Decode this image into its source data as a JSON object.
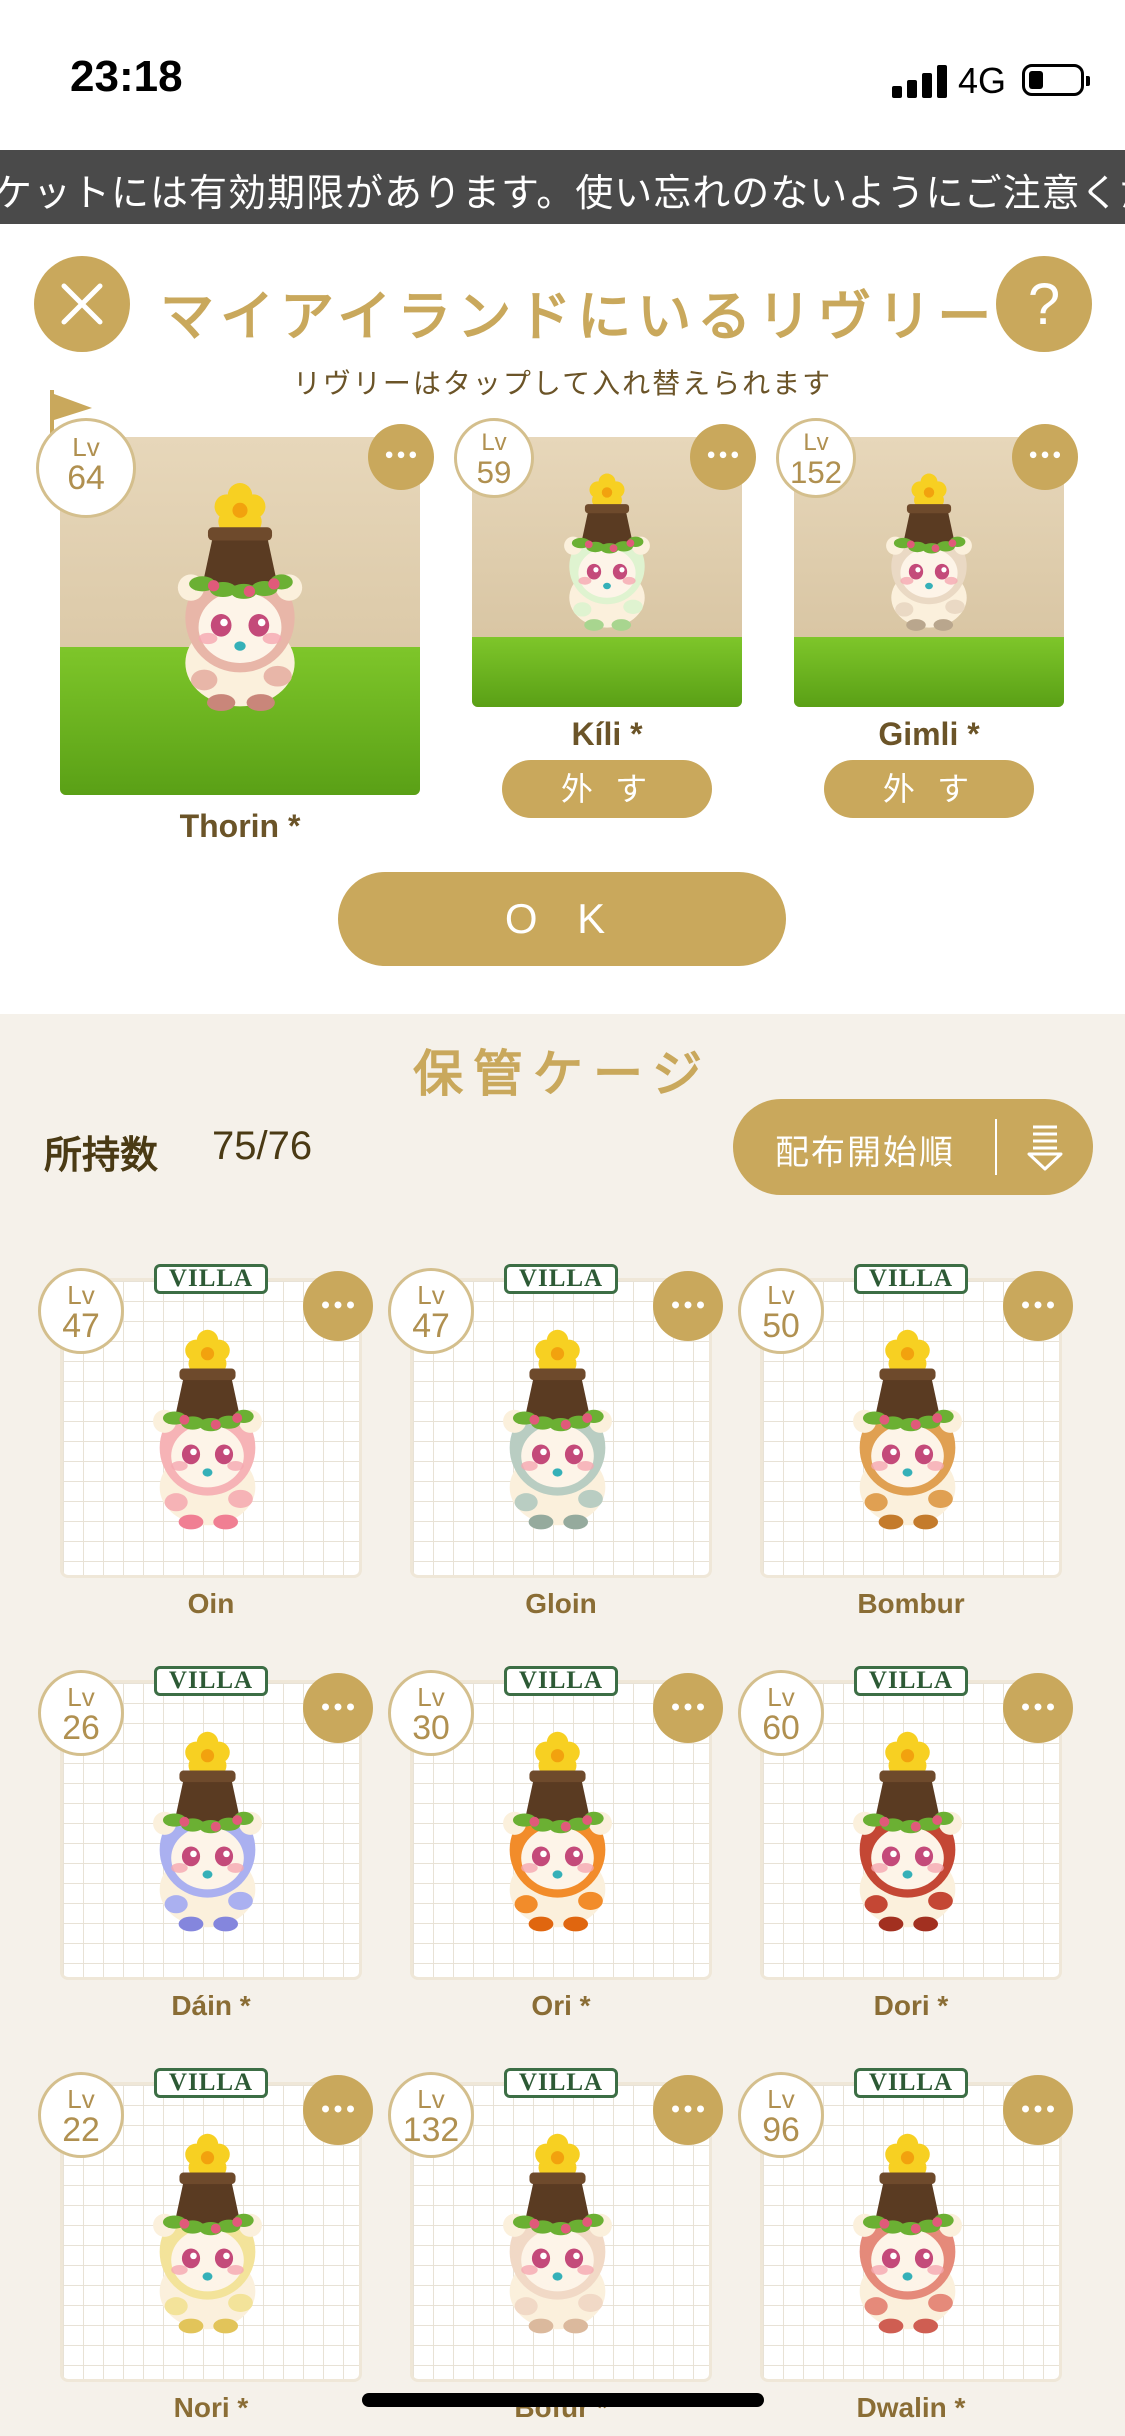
{
  "status": {
    "time": "23:18",
    "network": "4G"
  },
  "notice": "ケットには有効期限があります。使い忘れのないようにご注意ください",
  "header": {
    "title": "マイアイランドにいるリヴリー",
    "subtitle": "リヴリーはタップして入れ替えられます",
    "close_icon": "close-icon",
    "help_label": "?"
  },
  "island": [
    {
      "level_label": "Lv",
      "level": "64",
      "name": "Thorin *",
      "body_color": "#e8b6a8",
      "detail_color": "#c9867a",
      "leader": true
    },
    {
      "level_label": "Lv",
      "level": "59",
      "name": "Kíli *",
      "body_color": "#dff3d0",
      "detail_color": "#a8d58f",
      "remove_label": "外 す"
    },
    {
      "level_label": "Lv",
      "level": "152",
      "name": "Gimli *",
      "body_color": "#ead9c4",
      "detail_color": "#b9a68d",
      "remove_label": "外 す"
    }
  ],
  "ok_label": "O K",
  "more_label": "•••",
  "storage": {
    "title": "保管ケージ",
    "count_label": "所持数",
    "count": "75/76",
    "sort_label": "配布開始順",
    "villa_label": "VILLA",
    "items": [
      {
        "level_label": "Lv",
        "level": "47",
        "name": "Oin",
        "body_color": "#f6b3b6",
        "detail_color": "#f07f93"
      },
      {
        "level_label": "Lv",
        "level": "47",
        "name": "Gloin",
        "body_color": "#b9cdc2",
        "detail_color": "#95aa9d"
      },
      {
        "level_label": "Lv",
        "level": "50",
        "name": "Bombur",
        "body_color": "#e0a052",
        "detail_color": "#c47b2c"
      },
      {
        "level_label": "Lv",
        "level": "26",
        "name": "Dáin *",
        "body_color": "#aab0f0",
        "detail_color": "#8486dd"
      },
      {
        "level_label": "Lv",
        "level": "30",
        "name": "Ori *",
        "body_color": "#f28c2a",
        "detail_color": "#e0660f"
      },
      {
        "level_label": "Lv",
        "level": "60",
        "name": "Dori *",
        "body_color": "#c44734",
        "detail_color": "#a23020"
      },
      {
        "level_label": "Lv",
        "level": "22",
        "name": "Nori *",
        "body_color": "#f3e39a",
        "detail_color": "#e2c45a"
      },
      {
        "level_label": "Lv",
        "level": "132",
        "name": "Bofur *",
        "body_color": "#f1d9c6",
        "detail_color": "#dbb99d"
      },
      {
        "level_label": "Lv",
        "level": "96",
        "name": "Dwalin *",
        "body_color": "#e58a7a",
        "detail_color": "#cf5e52"
      }
    ]
  },
  "colors": {
    "accent": "#c9a85c",
    "text_dark": "#4a3a14",
    "grass": "#6cb31f",
    "villa_green": "#3c6e45"
  }
}
